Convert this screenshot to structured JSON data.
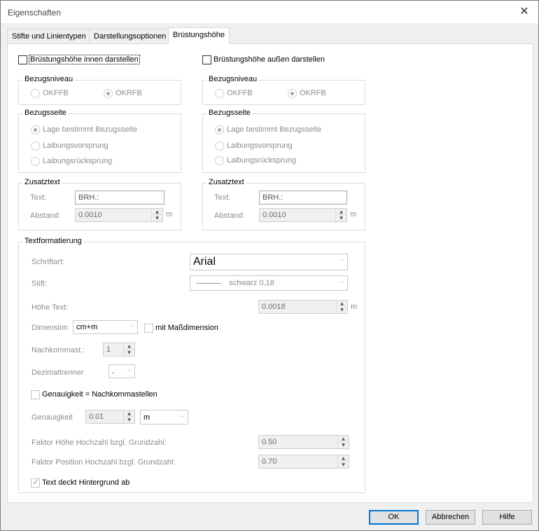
{
  "window": {
    "title": "Eigenschaften",
    "close_glyph": "✕"
  },
  "tabs": [
    {
      "label": "Stifte und Linientypen"
    },
    {
      "label": "Darstellungsoptionen"
    },
    {
      "label": "Brüstungshöhe"
    }
  ],
  "inner": {
    "show_label": "Brüstungshöhe innen darstellen",
    "show_checked": false,
    "bezugsniveau": {
      "title": "Bezugsniveau",
      "opt1": "OKFFB",
      "opt2": "OKRFB",
      "selected": "OKRFB"
    },
    "bezugsseite": {
      "title": "Bezugsseite",
      "opt1": "Lage bestimmt Bezugsseite",
      "opt2": "Laibungsvorsprung",
      "opt3": "Laibungsrücksprung",
      "selected": "Lage bestimmt Bezugsseite"
    },
    "zusatztext": {
      "title": "Zusatztext",
      "text_label": "Text:",
      "text_value": "BRH.:",
      "abstand_label": "Abstand:",
      "abstand_value": "0.0010",
      "unit": "m"
    }
  },
  "outer": {
    "show_label": "Brüstungshöhe außen darstellen",
    "show_checked": false,
    "bezugsniveau": {
      "title": "Bezugsniveau",
      "opt1": "OKFFB",
      "opt2": "OKRFB",
      "selected": "OKRFB"
    },
    "bezugsseite": {
      "title": "Bezugsseite",
      "opt1": "Lage bestimmt Bezugsseite",
      "opt2": "Laibungsvorsprung",
      "opt3": "Laibungsrücksprung",
      "selected": "Lage bestimmt Bezugsseite"
    },
    "zusatztext": {
      "title": "Zusatztext",
      "text_label": "Text:",
      "text_value": "BRH.:",
      "abstand_label": "Abstand:",
      "abstand_value": "0.0010",
      "unit": "m"
    }
  },
  "textformat": {
    "title": "Textformatierung",
    "schriftart_label": "Schriftart:",
    "schriftart_value": "Arial",
    "stift_label": "Stift:",
    "stift_value": "schwarz 0,18",
    "hoehe_label": "Höhe Text:",
    "hoehe_value": "0.0018",
    "hoehe_unit": "m",
    "dimension_label": "Dimension",
    "dimension_value": "cm+m",
    "massdim_label": "mit Maßdimension",
    "nachkomma_label": "Nachkommast.:",
    "nachkomma_value": "1",
    "dezimal_label": "Dezimaltrenner",
    "dezimal_value": ".",
    "genau_check_label": "Genauigkeit = Nachkommastellen",
    "genau_label": "Genauigkeit",
    "genau_value": "0.01",
    "genau_unit": "m",
    "faktor_hoehe_label": "Faktor Höhe Hochzahl bzgl. Grundzahl:",
    "faktor_hoehe_value": "0.50",
    "faktor_pos_label": "Faktor Position Hochzahl bzgl. Grundzahl:",
    "faktor_pos_value": "0.70",
    "hintergrund_label": "Text deckt Hintergrund ab",
    "hintergrund_checked": true
  },
  "buttons": {
    "ok": "OK",
    "cancel": "Abbrechen",
    "help": "Hilfe"
  },
  "icons": {
    "close": "close-icon",
    "spin_up": "▲",
    "spin_down": "▼",
    "dropdown": "⌵"
  }
}
